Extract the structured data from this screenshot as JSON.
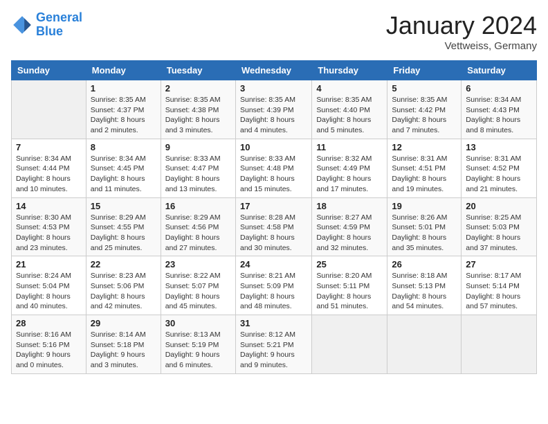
{
  "header": {
    "logo_general": "General",
    "logo_blue": "Blue",
    "month": "January 2024",
    "location": "Vettweiss, Germany"
  },
  "weekdays": [
    "Sunday",
    "Monday",
    "Tuesday",
    "Wednesday",
    "Thursday",
    "Friday",
    "Saturday"
  ],
  "weeks": [
    [
      {
        "day": "",
        "empty": true
      },
      {
        "day": "1",
        "sunrise": "Sunrise: 8:35 AM",
        "sunset": "Sunset: 4:37 PM",
        "daylight": "Daylight: 8 hours and 2 minutes."
      },
      {
        "day": "2",
        "sunrise": "Sunrise: 8:35 AM",
        "sunset": "Sunset: 4:38 PM",
        "daylight": "Daylight: 8 hours and 3 minutes."
      },
      {
        "day": "3",
        "sunrise": "Sunrise: 8:35 AM",
        "sunset": "Sunset: 4:39 PM",
        "daylight": "Daylight: 8 hours and 4 minutes."
      },
      {
        "day": "4",
        "sunrise": "Sunrise: 8:35 AM",
        "sunset": "Sunset: 4:40 PM",
        "daylight": "Daylight: 8 hours and 5 minutes."
      },
      {
        "day": "5",
        "sunrise": "Sunrise: 8:35 AM",
        "sunset": "Sunset: 4:42 PM",
        "daylight": "Daylight: 8 hours and 7 minutes."
      },
      {
        "day": "6",
        "sunrise": "Sunrise: 8:34 AM",
        "sunset": "Sunset: 4:43 PM",
        "daylight": "Daylight: 8 hours and 8 minutes."
      }
    ],
    [
      {
        "day": "7",
        "sunrise": "Sunrise: 8:34 AM",
        "sunset": "Sunset: 4:44 PM",
        "daylight": "Daylight: 8 hours and 10 minutes."
      },
      {
        "day": "8",
        "sunrise": "Sunrise: 8:34 AM",
        "sunset": "Sunset: 4:45 PM",
        "daylight": "Daylight: 8 hours and 11 minutes."
      },
      {
        "day": "9",
        "sunrise": "Sunrise: 8:33 AM",
        "sunset": "Sunset: 4:47 PM",
        "daylight": "Daylight: 8 hours and 13 minutes."
      },
      {
        "day": "10",
        "sunrise": "Sunrise: 8:33 AM",
        "sunset": "Sunset: 4:48 PM",
        "daylight": "Daylight: 8 hours and 15 minutes."
      },
      {
        "day": "11",
        "sunrise": "Sunrise: 8:32 AM",
        "sunset": "Sunset: 4:49 PM",
        "daylight": "Daylight: 8 hours and 17 minutes."
      },
      {
        "day": "12",
        "sunrise": "Sunrise: 8:31 AM",
        "sunset": "Sunset: 4:51 PM",
        "daylight": "Daylight: 8 hours and 19 minutes."
      },
      {
        "day": "13",
        "sunrise": "Sunrise: 8:31 AM",
        "sunset": "Sunset: 4:52 PM",
        "daylight": "Daylight: 8 hours and 21 minutes."
      }
    ],
    [
      {
        "day": "14",
        "sunrise": "Sunrise: 8:30 AM",
        "sunset": "Sunset: 4:53 PM",
        "daylight": "Daylight: 8 hours and 23 minutes."
      },
      {
        "day": "15",
        "sunrise": "Sunrise: 8:29 AM",
        "sunset": "Sunset: 4:55 PM",
        "daylight": "Daylight: 8 hours and 25 minutes."
      },
      {
        "day": "16",
        "sunrise": "Sunrise: 8:29 AM",
        "sunset": "Sunset: 4:56 PM",
        "daylight": "Daylight: 8 hours and 27 minutes."
      },
      {
        "day": "17",
        "sunrise": "Sunrise: 8:28 AM",
        "sunset": "Sunset: 4:58 PM",
        "daylight": "Daylight: 8 hours and 30 minutes."
      },
      {
        "day": "18",
        "sunrise": "Sunrise: 8:27 AM",
        "sunset": "Sunset: 4:59 PM",
        "daylight": "Daylight: 8 hours and 32 minutes."
      },
      {
        "day": "19",
        "sunrise": "Sunrise: 8:26 AM",
        "sunset": "Sunset: 5:01 PM",
        "daylight": "Daylight: 8 hours and 35 minutes."
      },
      {
        "day": "20",
        "sunrise": "Sunrise: 8:25 AM",
        "sunset": "Sunset: 5:03 PM",
        "daylight": "Daylight: 8 hours and 37 minutes."
      }
    ],
    [
      {
        "day": "21",
        "sunrise": "Sunrise: 8:24 AM",
        "sunset": "Sunset: 5:04 PM",
        "daylight": "Daylight: 8 hours and 40 minutes."
      },
      {
        "day": "22",
        "sunrise": "Sunrise: 8:23 AM",
        "sunset": "Sunset: 5:06 PM",
        "daylight": "Daylight: 8 hours and 42 minutes."
      },
      {
        "day": "23",
        "sunrise": "Sunrise: 8:22 AM",
        "sunset": "Sunset: 5:07 PM",
        "daylight": "Daylight: 8 hours and 45 minutes."
      },
      {
        "day": "24",
        "sunrise": "Sunrise: 8:21 AM",
        "sunset": "Sunset: 5:09 PM",
        "daylight": "Daylight: 8 hours and 48 minutes."
      },
      {
        "day": "25",
        "sunrise": "Sunrise: 8:20 AM",
        "sunset": "Sunset: 5:11 PM",
        "daylight": "Daylight: 8 hours and 51 minutes."
      },
      {
        "day": "26",
        "sunrise": "Sunrise: 8:18 AM",
        "sunset": "Sunset: 5:13 PM",
        "daylight": "Daylight: 8 hours and 54 minutes."
      },
      {
        "day": "27",
        "sunrise": "Sunrise: 8:17 AM",
        "sunset": "Sunset: 5:14 PM",
        "daylight": "Daylight: 8 hours and 57 minutes."
      }
    ],
    [
      {
        "day": "28",
        "sunrise": "Sunrise: 8:16 AM",
        "sunset": "Sunset: 5:16 PM",
        "daylight": "Daylight: 9 hours and 0 minutes."
      },
      {
        "day": "29",
        "sunrise": "Sunrise: 8:14 AM",
        "sunset": "Sunset: 5:18 PM",
        "daylight": "Daylight: 9 hours and 3 minutes."
      },
      {
        "day": "30",
        "sunrise": "Sunrise: 8:13 AM",
        "sunset": "Sunset: 5:19 PM",
        "daylight": "Daylight: 9 hours and 6 minutes."
      },
      {
        "day": "31",
        "sunrise": "Sunrise: 8:12 AM",
        "sunset": "Sunset: 5:21 PM",
        "daylight": "Daylight: 9 hours and 9 minutes."
      },
      {
        "day": "",
        "empty": true
      },
      {
        "day": "",
        "empty": true
      },
      {
        "day": "",
        "empty": true
      }
    ]
  ]
}
